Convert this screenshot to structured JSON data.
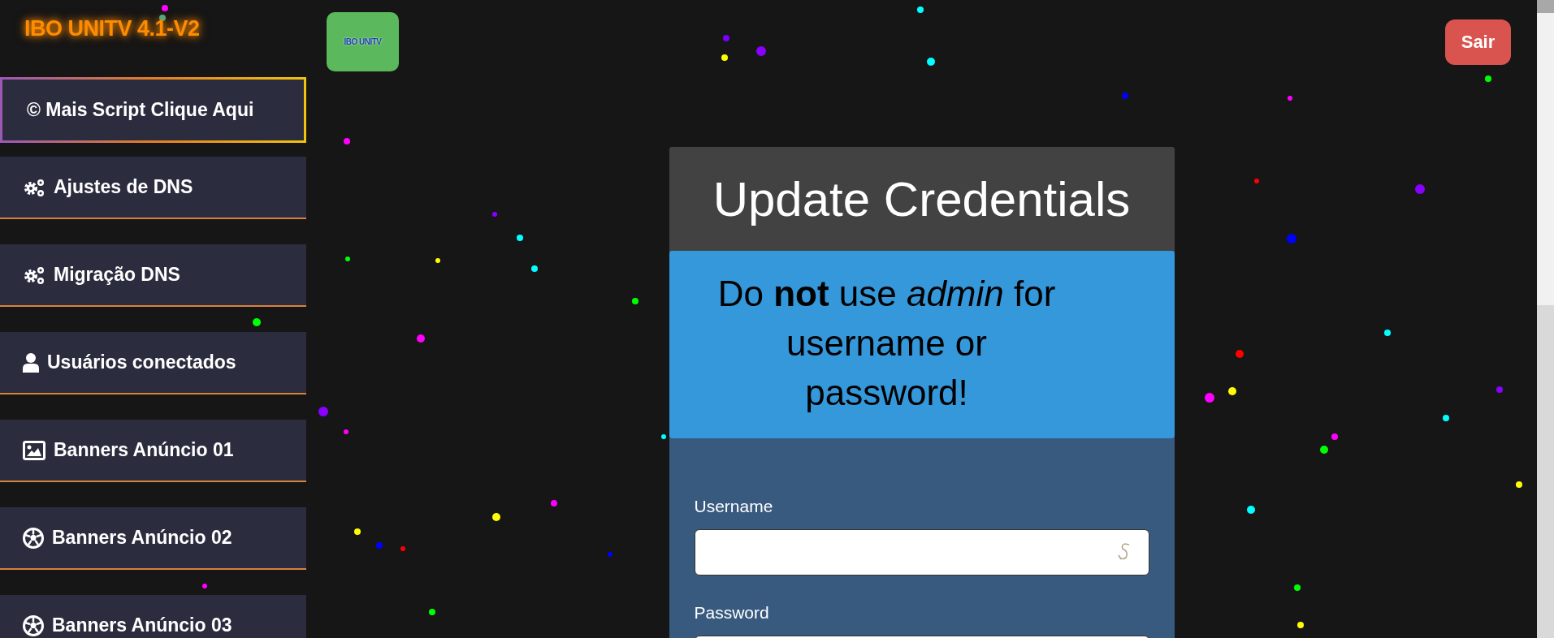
{
  "brand": {
    "title": "IBO UNITV 4.1-V2",
    "logo_text": "IBO UNITV"
  },
  "sidebar": {
    "items": [
      {
        "label": "© Mais Script Clique Aqui",
        "kind": "featured"
      },
      {
        "label": "Ajustes de DNS",
        "kind": "settings"
      },
      {
        "label": "Migração DNS",
        "kind": "settings"
      },
      {
        "label": "Usuários conectados",
        "kind": "user"
      },
      {
        "label": "Banners Anúncio 01",
        "kind": "image"
      },
      {
        "label": "Banners Anúncio 02",
        "kind": "ball"
      },
      {
        "label": "Banners Anúncio 03",
        "kind": "ball"
      }
    ]
  },
  "logout_button": "Sair",
  "card": {
    "title": "Update Credentials",
    "alert": "Do **not** use *admin* for username or password!",
    "fields": [
      {
        "label": "Username"
      },
      {
        "label": "Password"
      }
    ]
  }
}
